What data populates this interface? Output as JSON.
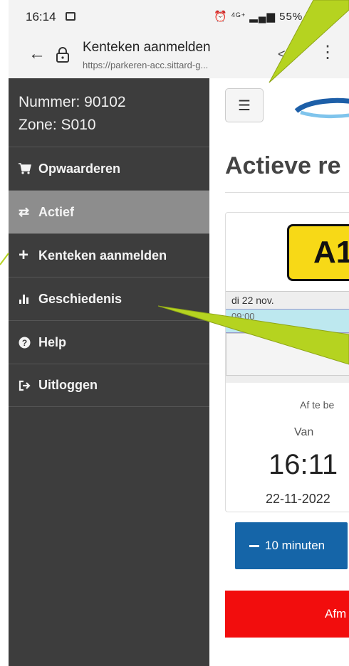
{
  "status": {
    "time": "16:14",
    "network": "4G+",
    "battery": "55%"
  },
  "browser": {
    "title": "Kenteken aanmelden",
    "url": "https://parkeren-acc.sittard-g..."
  },
  "drawer": {
    "account_number": "Nummer: 90102",
    "account_zone": "Zone: S010",
    "items": [
      {
        "label": "Opwaarderen",
        "icon": "cart-icon"
      },
      {
        "label": "Actief",
        "icon": "exchange-icon",
        "active": true
      },
      {
        "label": "Kenteken aanmelden",
        "icon": "plus-icon"
      },
      {
        "label": "Geschiedenis",
        "icon": "bar-chart-icon"
      },
      {
        "label": "Help",
        "icon": "question-circle-icon"
      },
      {
        "label": "Uitloggen",
        "icon": "sign-out-icon"
      }
    ]
  },
  "page": {
    "title": "Actieve re",
    "plate": "A1",
    "calendar_day": "di 22 nov.",
    "calendar_time": "09:00",
    "sub_label": "Af te be",
    "from_label": "Van",
    "from_time": "16:11",
    "from_date": "22-11-2022",
    "minutes_button": "10 minuten",
    "afmelden_button": "Afm"
  },
  "colors": {
    "drawer_bg": "#3d3d3d",
    "active_item_bg": "#8d8d8d",
    "plate_yellow": "#f7d917",
    "blue_button": "#1565a8",
    "red_button": "#f20d0d",
    "callout_green": "#b5d320"
  }
}
